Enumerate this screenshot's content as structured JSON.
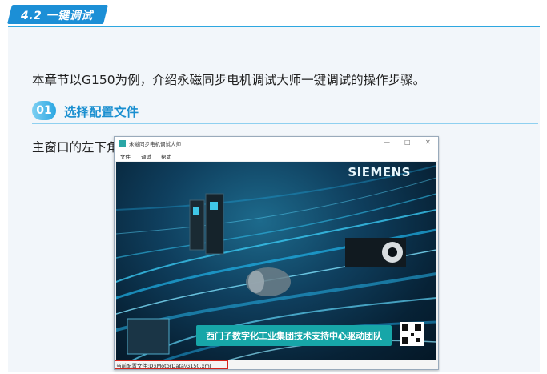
{
  "section": {
    "label": "4.2 一键调试"
  },
  "intro": "本章节以G150为例，介绍永磁同步电机调试大师一键调试的操作步骤。",
  "step": {
    "number": "01",
    "title": "选择配置文件"
  },
  "description": "主窗口的左下角会显示当前使用的配置文件。",
  "app_window": {
    "title": "永磁同步电机调试大师",
    "controls": {
      "minimize": "—",
      "maximize": "□",
      "close": "✕"
    },
    "menu": [
      "文件",
      "调试",
      "帮助"
    ],
    "banner_brand": "SIEMENS",
    "banner_caption": "西门子数字化工业集团技术支持中心驱动团队",
    "status_text": "当前配置文件:D:\\MotorData\\G150.xml"
  },
  "colors": {
    "accent": "#1c8fd6",
    "highlight_box": "#d6251c",
    "caption_bg": "#17a6a8"
  }
}
